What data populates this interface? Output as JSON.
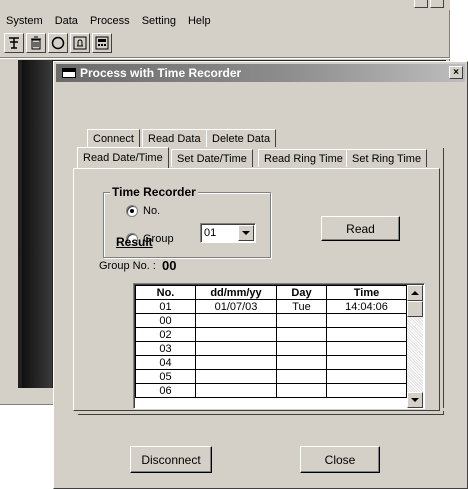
{
  "app": {
    "menu": [
      "System",
      "Data",
      "Process",
      "Setting",
      "Help"
    ],
    "toolbar_icons": [
      "connect-icon",
      "trash-icon",
      "clock-icon",
      "alarm-bell-icon",
      "calculator-icon"
    ]
  },
  "dialog": {
    "title": "Process with Time Recorder",
    "close": "×",
    "tabs_row1": [
      "Connect",
      "Read Data",
      "Delete Data"
    ],
    "tabs_row2": [
      "Read Date/Time",
      "Set Date/Time",
      "Read Ring Time",
      "Set Ring Time"
    ],
    "active_tab": "Read Date/Time"
  },
  "recorder": {
    "title": "Time Recorder",
    "radio_no": "No.",
    "radio_group": "Group",
    "selected_radio": "No.",
    "select_value": "01",
    "read_button": "Read"
  },
  "result": {
    "label": "Result",
    "group_no_label": "Group No. :",
    "group_no_value": "00",
    "columns": [
      "No.",
      "dd/mm/yy",
      "Day",
      "Time"
    ],
    "rows": [
      [
        "01",
        "01/07/03",
        "Tue",
        "14:04:06"
      ],
      [
        "00",
        "",
        "",
        ""
      ],
      [
        "02",
        "",
        "",
        ""
      ],
      [
        "03",
        "",
        "",
        ""
      ],
      [
        "04",
        "",
        "",
        ""
      ],
      [
        "05",
        "",
        "",
        ""
      ],
      [
        "06",
        "",
        "",
        ""
      ]
    ]
  },
  "footer": {
    "disconnect": "Disconnect",
    "close": "Close"
  }
}
